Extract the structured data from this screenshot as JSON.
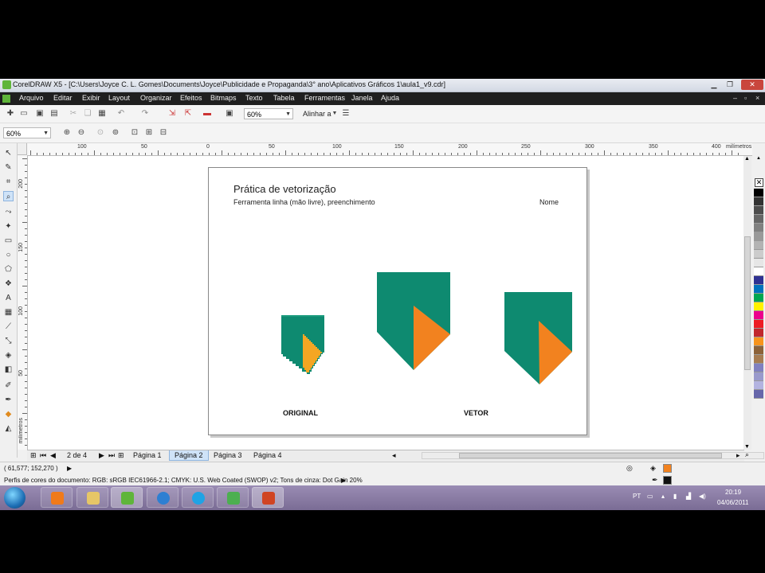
{
  "window": {
    "title": "CorelDRAW X5 - [C:\\Users\\Joyce C. L. Gomes\\Documents\\Joyce\\Publicidade e Propaganda\\3° ano\\Aplicativos Gráficos 1\\aula1_v9.cdr]"
  },
  "menu": [
    "Arquivo",
    "Editar",
    "Exibir",
    "Layout",
    "Organizar",
    "Efeitos",
    "Bitmaps",
    "Texto",
    "Tabela",
    "Ferramentas",
    "Janela",
    "Ajuda"
  ],
  "toolbar": {
    "zoom_value": "60%",
    "align_label": "Alinhar a"
  },
  "property_bar": {
    "zoom_value": "60%"
  },
  "ruler": {
    "h_labels": [
      "100",
      "50",
      "0",
      "50",
      "100",
      "150",
      "200",
      "250",
      "300",
      "350",
      "400",
      "milímetros"
    ],
    "v_labels": [
      "200",
      "150",
      "100",
      "50",
      "milímetros"
    ]
  },
  "page": {
    "title": "Prática de vetorização",
    "subtitle": "Ferramenta linha (mão livre), preenchimento",
    "name_label": "Nome",
    "label_original": "ORIGINAL",
    "label_vetor": "VETOR"
  },
  "colors": {
    "teal": "#0e8a70",
    "orange": "#f2821f",
    "orange_light": "#f5a623"
  },
  "pagenav": {
    "counter": "2 de 4",
    "tabs": [
      {
        "label": "Página 1",
        "active": false
      },
      {
        "label": "Página 2",
        "active": true
      },
      {
        "label": "Página 3",
        "active": false
      },
      {
        "label": "Página 4",
        "active": false
      }
    ]
  },
  "status": {
    "coords": "( 61,577; 152,270 )",
    "color_profile": "Perfis de cores do documento: RGB: sRGB IEC61966-2.1; CMYK: U.S. Web Coated (SWOP) v2; Tons de cinza: Dot Gain 20%"
  },
  "taskbar": {
    "lang": "PT",
    "time": "20:19",
    "date": "04/06/2011"
  },
  "palette": [
    "#000000",
    "#333333",
    "#4d4d4d",
    "#666666",
    "#808080",
    "#999999",
    "#b3b3b3",
    "#cccccc",
    "#e6e6e6",
    "#ffffff",
    "#2e3192",
    "#0072bc",
    "#00a651",
    "#fff200",
    "#ec008c",
    "#ed1c24",
    "#c1272d",
    "#f7941d",
    "#8c6239",
    "#a67c52",
    "#8080c0",
    "#9999cc",
    "#b3b3e0",
    "#6666aa"
  ]
}
